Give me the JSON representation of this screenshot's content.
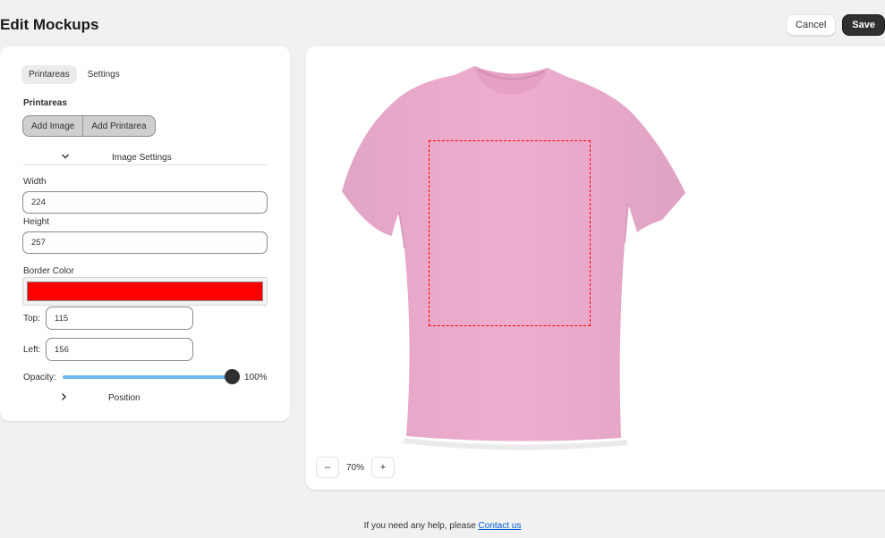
{
  "page": {
    "title": "Edit Mockups"
  },
  "actions": {
    "cancel": "Cancel",
    "save": "Save"
  },
  "tabs": [
    {
      "label": "Printareas",
      "active": true
    },
    {
      "label": "Settings",
      "active": false
    }
  ],
  "printareas": {
    "section_label": "Printareas",
    "add_image": "Add Image",
    "add_printarea": "Add Printarea"
  },
  "image_settings": {
    "title": "Image Settings",
    "width_label": "Width",
    "width_value": "224",
    "height_label": "Height",
    "height_value": "257",
    "border_color_label": "Border Color",
    "border_color": "#ff0000",
    "top_label": "Top:",
    "top_value": "115",
    "left_label": "Left:",
    "left_value": "156",
    "opacity_label": "Opacity:",
    "opacity_value": "100%",
    "opacity_fraction": 1.0
  },
  "position": {
    "label": "Position"
  },
  "canvas": {
    "shirt_color": "#eeadcf",
    "zoom_out": "–",
    "zoom_value": "70%",
    "zoom_in": "+"
  },
  "footer": {
    "text": "If you need any help, please ",
    "link": "Contact us"
  }
}
